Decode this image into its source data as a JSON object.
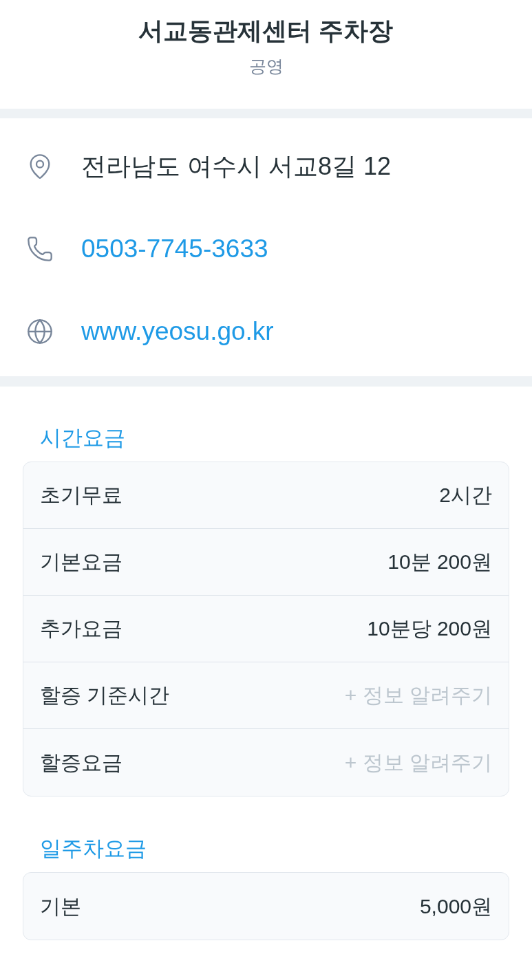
{
  "header": {
    "title": "서교동관제센터 주차장",
    "subtitle": "공영"
  },
  "contact": [
    {
      "kind": "address",
      "text": "전라남도 여수시 서교8길 12"
    },
    {
      "kind": "phone",
      "text": "0503-7745-3633"
    },
    {
      "kind": "website",
      "text": "www.yeosu.go.kr"
    }
  ],
  "fee_sections": [
    {
      "title": "시간요금",
      "rows": [
        {
          "kind": "value",
          "label": "초기무료",
          "value": "2시간"
        },
        {
          "kind": "value",
          "label": "기본요금",
          "value": "10분 200원"
        },
        {
          "kind": "value",
          "label": "추가요금",
          "value": "10분당 200원"
        },
        {
          "kind": "suggest",
          "label": "할증 기준시간",
          "value": "+ 정보 알려주기"
        },
        {
          "kind": "suggest",
          "label": "할증요금",
          "value": "+ 정보 알려주기"
        }
      ]
    },
    {
      "title": "일주차요금",
      "rows": [
        {
          "kind": "value",
          "label": "기본",
          "value": "5,000원"
        }
      ]
    }
  ]
}
